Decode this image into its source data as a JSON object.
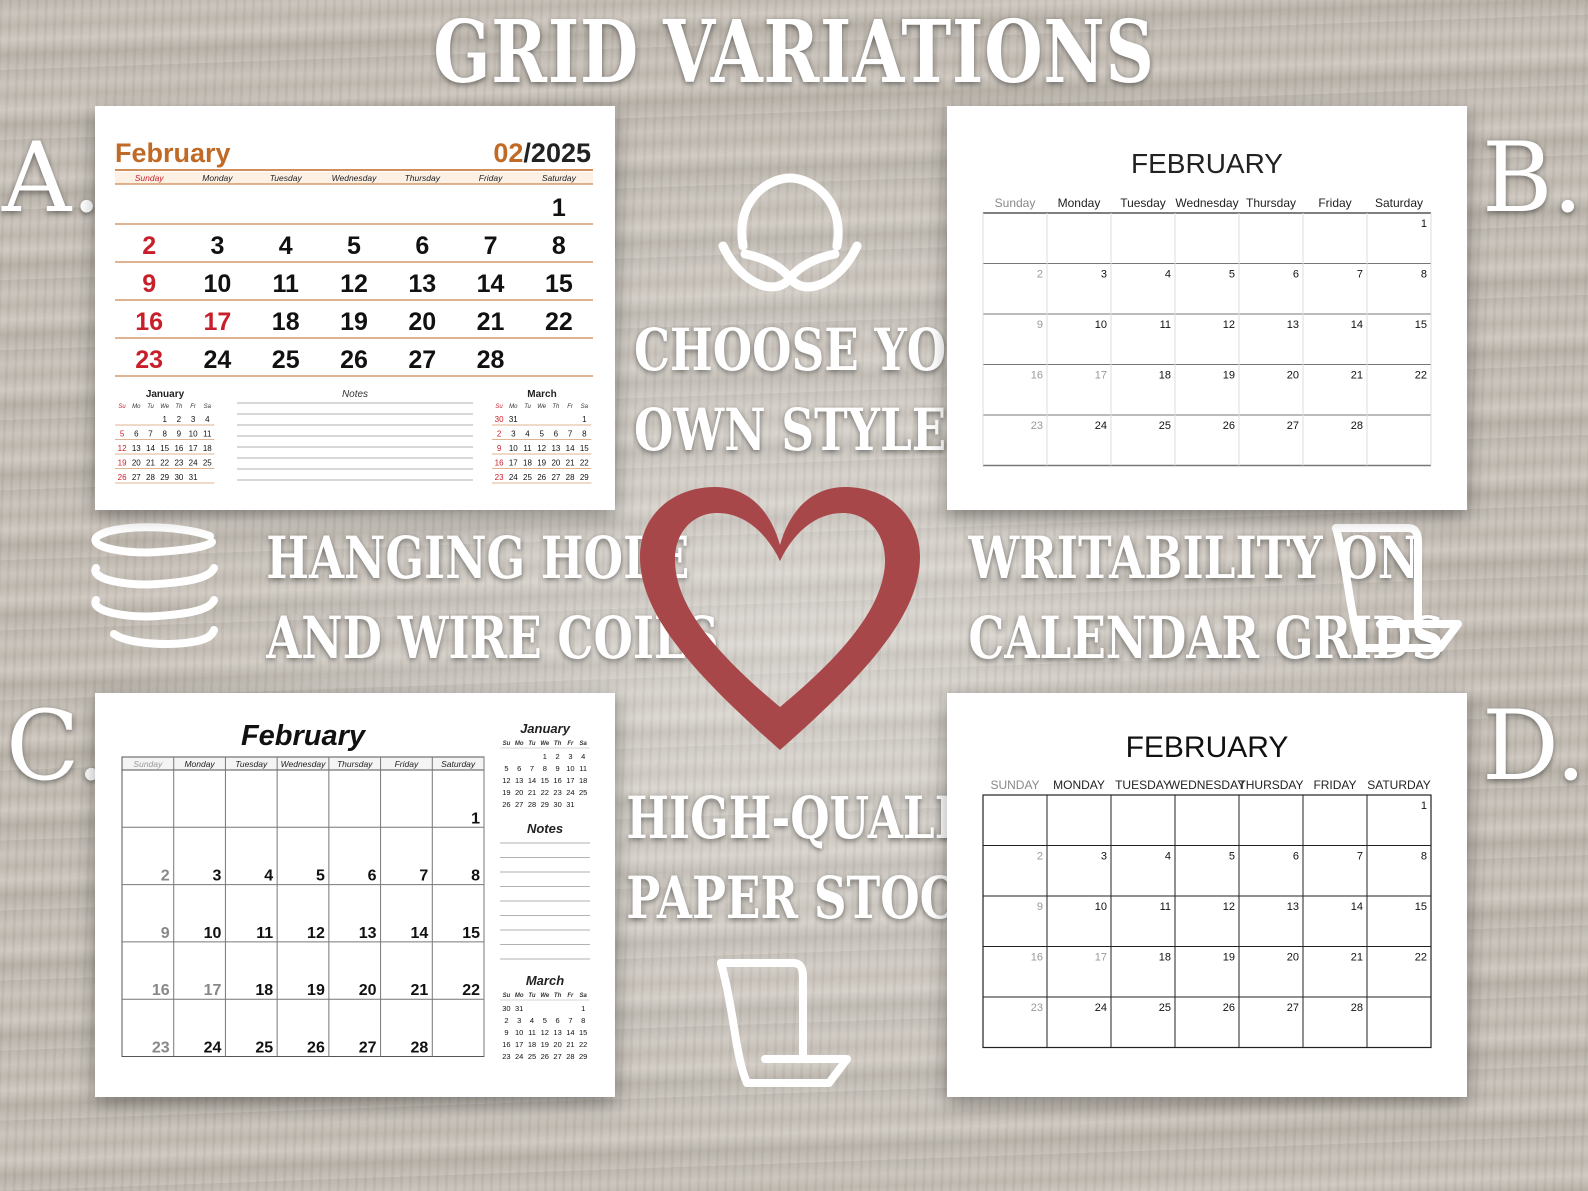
{
  "title": "GRID VARIATIONS",
  "letters": {
    "a": "A.",
    "b": "B.",
    "c": "C.",
    "d": "D."
  },
  "features": {
    "style_1": "CHOOSE YOUR",
    "style_2": "OWN STYLE",
    "hanging_1": "HANGING HOLE",
    "hanging_2": "AND WIRE COILS",
    "writ_1": "WRITABILITY ON",
    "writ_2": "CALENDAR GRIDS",
    "paper_1": "HIGH-QUALITY",
    "paper_2": "PAPER STOCK"
  },
  "colors": {
    "heart": "#a84749",
    "accent_orange": "#c06a26",
    "holiday_red": "#c8202a"
  },
  "icons": [
    "lotus-icon",
    "coil-icon",
    "paper-sheet-icon",
    "heart-icon"
  ],
  "weekdays": [
    "Sunday",
    "Monday",
    "Tuesday",
    "Wednesday",
    "Thursday",
    "Friday",
    "Saturday"
  ],
  "weekdays_upper": [
    "SUNDAY",
    "MONDAY",
    "TUESDAY",
    "WEDNESDAY",
    "THURSDAY",
    "FRIDAY",
    "SATURDAY"
  ],
  "weekdays_short": [
    "Su",
    "Mo",
    "Tu",
    "We",
    "Th",
    "Fr",
    "Sa"
  ],
  "feb_weeks": [
    [
      "",
      "",
      "",
      "",
      "",
      "",
      "1"
    ],
    [
      "2",
      "3",
      "4",
      "5",
      "6",
      "7",
      "8"
    ],
    [
      "9",
      "10",
      "11",
      "12",
      "13",
      "14",
      "15"
    ],
    [
      "16",
      "17",
      "18",
      "19",
      "20",
      "21",
      "22"
    ],
    [
      "23",
      "24",
      "25",
      "26",
      "27",
      "28",
      ""
    ]
  ],
  "jan_weeks": [
    [
      "",
      "",
      "",
      "1",
      "2",
      "3",
      "4"
    ],
    [
      "5",
      "6",
      "7",
      "8",
      "9",
      "10",
      "11"
    ],
    [
      "12",
      "13",
      "14",
      "15",
      "16",
      "17",
      "18"
    ],
    [
      "19",
      "20",
      "21",
      "22",
      "23",
      "24",
      "25"
    ],
    [
      "26",
      "27",
      "28",
      "29",
      "30",
      "31",
      ""
    ]
  ],
  "mar_weeks": [
    [
      "30",
      "31",
      "",
      "",
      "",
      "",
      "1"
    ],
    [
      "2",
      "3",
      "4",
      "5",
      "6",
      "7",
      "8"
    ],
    [
      "9",
      "10",
      "11",
      "12",
      "13",
      "14",
      "15"
    ],
    [
      "16",
      "17",
      "18",
      "19",
      "20",
      "21",
      "22"
    ],
    [
      "23",
      "24",
      "25",
      "26",
      "27",
      "28",
      "29"
    ]
  ],
  "card_a": {
    "month": "February",
    "num": "02",
    "year": "/2025",
    "mini_left": "January",
    "notes": "Notes",
    "mini_right": "March"
  },
  "card_b": {
    "month": "FEBRUARY"
  },
  "card_c": {
    "month": "February",
    "mini_top": "January",
    "notes": "Notes",
    "mini_bottom": "March"
  },
  "card_d": {
    "month": "FEBRUARY"
  }
}
